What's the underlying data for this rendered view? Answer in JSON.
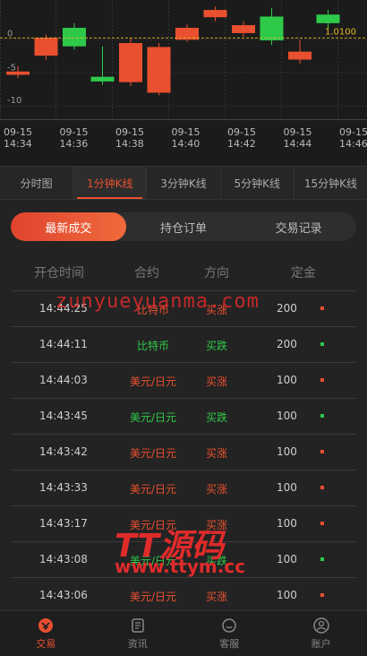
{
  "chart": {
    "type": "candlestick",
    "y_ticks": [
      "0",
      "-5",
      "-10"
    ],
    "current_price": "1.0100",
    "x_labels": [
      {
        "date": "09-15",
        "time": "14:34"
      },
      {
        "date": "09-15",
        "time": "14:36"
      },
      {
        "date": "09-15",
        "time": "14:38"
      },
      {
        "date": "09-15",
        "time": "14:40"
      },
      {
        "date": "09-15",
        "time": "14:42"
      },
      {
        "date": "09-15",
        "time": "14:44"
      },
      {
        "date": "09-15",
        "time": "14:46"
      }
    ],
    "candles": [
      {
        "open": -4.8,
        "close": -5.3,
        "high": -4.0,
        "low": -5.8,
        "color": "red"
      },
      {
        "open": 0.3,
        "close": -2.4,
        "high": 0.8,
        "low": -3.0,
        "color": "red"
      },
      {
        "open": -1.0,
        "close": 1.8,
        "high": 2.5,
        "low": -1.5,
        "color": "green"
      },
      {
        "open": -6.3,
        "close": -5.6,
        "high": -1.0,
        "low": -6.8,
        "color": "green"
      },
      {
        "open": -0.5,
        "close": -6.4,
        "high": 0.2,
        "low": -7.0,
        "color": "red"
      },
      {
        "open": -1.1,
        "close": -8.0,
        "high": -0.5,
        "low": -8.4,
        "color": "red"
      },
      {
        "open": 1.8,
        "close": 0.0,
        "high": 2.3,
        "low": -0.3,
        "color": "red"
      },
      {
        "open": 4.5,
        "close": 3.4,
        "high": 5.0,
        "low": 2.8,
        "color": "red"
      },
      {
        "open": 2.2,
        "close": 1.0,
        "high": 2.8,
        "low": 0.5,
        "color": "red"
      },
      {
        "open": -0.1,
        "close": 3.5,
        "high": 4.8,
        "low": -0.8,
        "color": "green"
      },
      {
        "open": -1.8,
        "close": -3.0,
        "high": 0.0,
        "low": -3.6,
        "color": "red"
      },
      {
        "open": 2.5,
        "close": 3.8,
        "high": 4.5,
        "low": 1.5,
        "color": "green"
      }
    ]
  },
  "tabs": [
    "分时图",
    "1分钟K线",
    "3分钟K线",
    "5分钟K线",
    "15分钟K线"
  ],
  "segments": [
    "最新成交",
    "持仓订单",
    "交易记录"
  ],
  "table": {
    "headers": [
      "开仓时间",
      "合约",
      "方向",
      "定金"
    ],
    "rows": [
      {
        "time": "14:44:25",
        "contract": "比特币",
        "direction": "买涨",
        "amount": "200",
        "color": "red"
      },
      {
        "time": "14:44:11",
        "contract": "比特币",
        "direction": "买跌",
        "amount": "200",
        "color": "green"
      },
      {
        "time": "14:44:03",
        "contract": "美元/日元",
        "direction": "买涨",
        "amount": "100",
        "color": "red"
      },
      {
        "time": "14:43:45",
        "contract": "美元/日元",
        "direction": "买跌",
        "amount": "100",
        "color": "green"
      },
      {
        "time": "14:43:42",
        "contract": "美元/日元",
        "direction": "买涨",
        "amount": "100",
        "color": "red"
      },
      {
        "time": "14:43:33",
        "contract": "美元/日元",
        "direction": "买涨",
        "amount": "100",
        "color": "red"
      },
      {
        "time": "14:43:17",
        "contract": "美元/日元",
        "direction": "买涨",
        "amount": "100",
        "color": "red"
      },
      {
        "time": "14:43:08",
        "contract": "美元/日元",
        "direction": "买跌",
        "amount": "100",
        "color": "green"
      },
      {
        "time": "14:43:06",
        "contract": "美元/日元",
        "direction": "买涨",
        "amount": "100",
        "color": "red"
      }
    ]
  },
  "watermarks": [
    "zunyueyuanma.com",
    "TT源码",
    "www.ttym.cc"
  ],
  "nav": [
    {
      "label": "交易",
      "icon": "trade-icon"
    },
    {
      "label": "资讯",
      "icon": "news-icon"
    },
    {
      "label": "客服",
      "icon": "service-icon"
    },
    {
      "label": "账户",
      "icon": "account-icon"
    }
  ],
  "colors": {
    "accent": "#e9502f",
    "up": "#2fc94a",
    "down": "#e9502f",
    "price_label": "#e8b923"
  }
}
